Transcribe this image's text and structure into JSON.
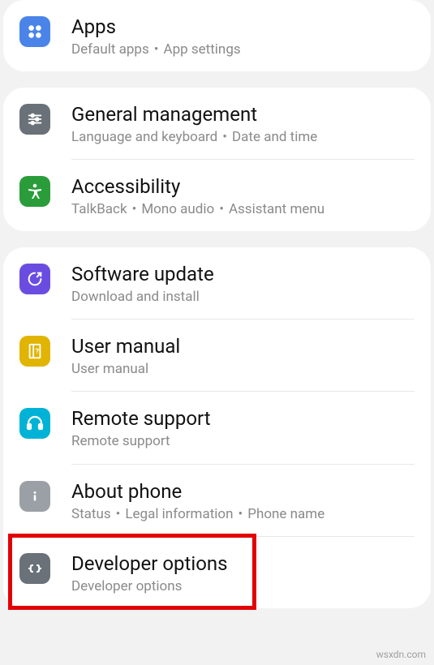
{
  "groups": [
    {
      "items": [
        {
          "key": "apps",
          "title": "Apps",
          "sub_parts": [
            "Default apps",
            "App settings"
          ],
          "icon": {
            "name": "apps-icon",
            "bg": "#4a84e9"
          }
        }
      ]
    },
    {
      "items": [
        {
          "key": "general-management",
          "title": "General management",
          "sub_parts": [
            "Language and keyboard",
            "Date and time"
          ],
          "icon": {
            "name": "sliders-icon",
            "bg": "#6b7179"
          }
        },
        {
          "key": "accessibility",
          "title": "Accessibility",
          "sub_parts": [
            "TalkBack",
            "Mono audio",
            "Assistant menu"
          ],
          "icon": {
            "name": "accessibility-icon",
            "bg": "#2a9d3a"
          }
        }
      ]
    },
    {
      "items": [
        {
          "key": "software-update",
          "title": "Software update",
          "sub_parts": [
            "Download and install"
          ],
          "icon": {
            "name": "update-icon",
            "bg": "#6a4de0"
          }
        },
        {
          "key": "user-manual",
          "title": "User manual",
          "sub_parts": [
            "User manual"
          ],
          "icon": {
            "name": "manual-icon",
            "bg": "#e0b400"
          }
        },
        {
          "key": "remote-support",
          "title": "Remote support",
          "sub_parts": [
            "Remote support"
          ],
          "icon": {
            "name": "headset-icon",
            "bg": "#00b3d6"
          }
        },
        {
          "key": "about-phone",
          "title": "About phone",
          "sub_parts": [
            "Status",
            "Legal information",
            "Phone name"
          ],
          "icon": {
            "name": "info-icon",
            "bg": "#9aa0a6"
          }
        },
        {
          "key": "developer-options",
          "title": "Developer options",
          "sub_parts": [
            "Developer options"
          ],
          "icon": {
            "name": "code-icon",
            "bg": "#6b7179"
          },
          "highlighted": true
        }
      ]
    }
  ],
  "watermark": "wsxdn.com",
  "colors": {
    "highlight": "#e20000",
    "bg": "#f2f2f2",
    "card": "#ffffff",
    "sub": "#8a8a8a"
  },
  "dot_separator": "•"
}
